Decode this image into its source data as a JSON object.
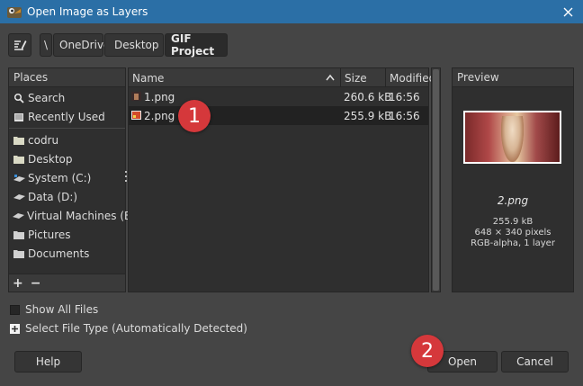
{
  "window": {
    "title": "Open Image as Layers"
  },
  "path": {
    "crumbs": [
      "\\",
      "OneDrive",
      "Desktop",
      "GIF Project"
    ]
  },
  "places": {
    "header": "Places",
    "items": [
      "Search",
      "Recently Used",
      "codru",
      "Desktop",
      "System (C:)",
      "Data (D:)",
      "Virtual Machines (E:)",
      "Pictures",
      "Documents"
    ],
    "add_label": "+",
    "remove_label": "−"
  },
  "files": {
    "columns": {
      "name": "Name",
      "size": "Size",
      "modified": "Modified"
    },
    "rows": [
      {
        "name": "1.png",
        "size": "260.6 kB",
        "modified": "16:56"
      },
      {
        "name": "2.png",
        "size": "255.9 kB",
        "modified": "16:56"
      }
    ]
  },
  "preview": {
    "header": "Preview",
    "filename": "2.png",
    "size": "255.9 kB",
    "dimensions": "648 × 340 pixels",
    "mode": "RGB-alpha, 1 layer"
  },
  "options": {
    "show_all_files": "Show All Files",
    "select_file_type": "Select File Type (Automatically Detected)"
  },
  "buttons": {
    "help": "Help",
    "open": "Open",
    "cancel": "Cancel"
  },
  "badges": {
    "one": "1",
    "two": "2"
  },
  "colors": {
    "titlebar": "#2b6fa6",
    "badge": "#d5383b",
    "dialog_bg": "#454545"
  }
}
